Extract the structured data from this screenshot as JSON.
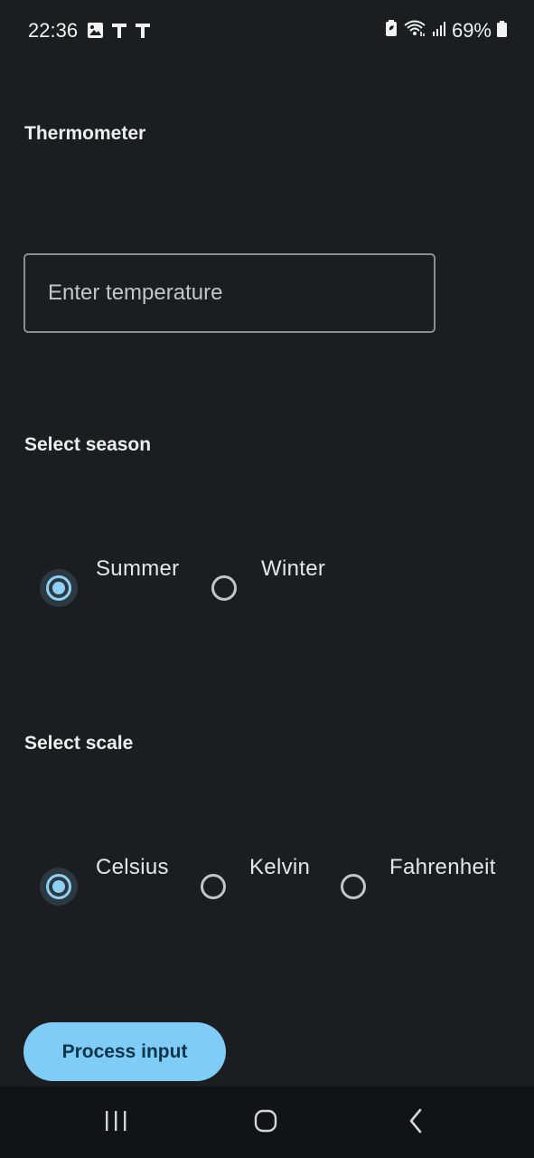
{
  "status_bar": {
    "time": "22:36",
    "battery": "69%",
    "left_icons": [
      "image-icon",
      "t-icon",
      "t-icon"
    ],
    "right_icons": [
      "battery-saver-icon",
      "wifi-icon",
      "signal-icon",
      "battery-icon"
    ]
  },
  "app": {
    "title": "Thermometer"
  },
  "temperature": {
    "placeholder": "Enter temperature",
    "value": ""
  },
  "season": {
    "label": "Select season",
    "selected": "Summer",
    "options": [
      "Summer",
      "Winter"
    ]
  },
  "scale": {
    "label": "Select scale",
    "selected": "Celsius",
    "options": [
      "Celsius",
      "Kelvin",
      "Fahrenheit"
    ]
  },
  "actions": {
    "process_label": "Process input"
  },
  "nav": {
    "icons": [
      "recent-apps-icon",
      "home-icon",
      "back-icon"
    ]
  },
  "colors": {
    "background": "#1b1d20",
    "accent": "#7fcdf7",
    "nav_background": "#121315"
  }
}
